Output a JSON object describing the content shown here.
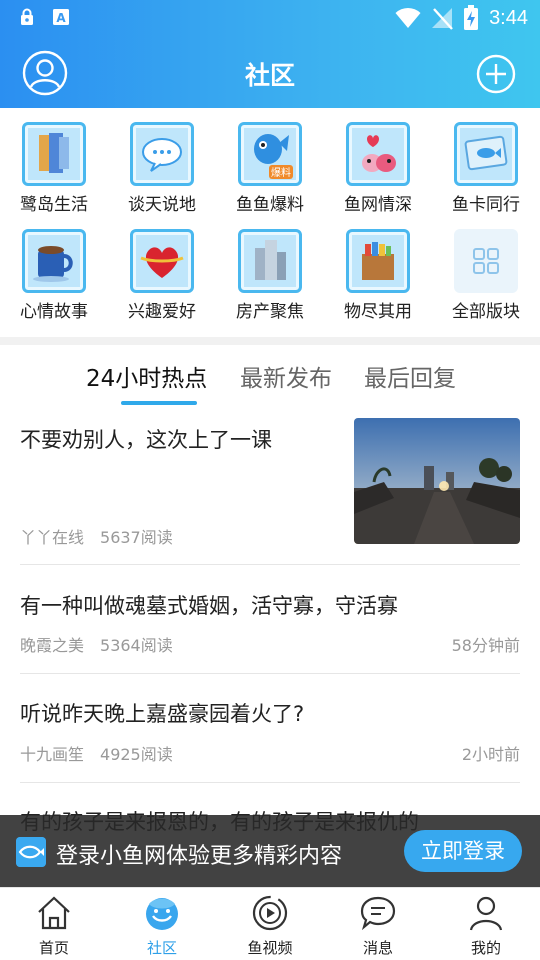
{
  "status_bar": {
    "time": "3:44"
  },
  "header": {
    "title": "社区"
  },
  "forums": [
    {
      "label": "鹭岛生活",
      "icon": "doors-icon"
    },
    {
      "label": "谈天说地",
      "icon": "chat-bubble-icon"
    },
    {
      "label": "鱼鱼爆料",
      "icon": "fish-mascot-icon",
      "badge": "爆料"
    },
    {
      "label": "鱼网情深",
      "icon": "fish-heart-icon"
    },
    {
      "label": "鱼卡同行",
      "icon": "fish-card-icon"
    },
    {
      "label": "心情故事",
      "icon": "coffee-cup-icon"
    },
    {
      "label": "兴趣爱好",
      "icon": "heart-ribbon-icon"
    },
    {
      "label": "房产聚焦",
      "icon": "buildings-icon"
    },
    {
      "label": "物尽其用",
      "icon": "box-icon"
    },
    {
      "label": "全部版块",
      "icon": "grid-icon"
    }
  ],
  "tabs": [
    {
      "label": "24小时热点",
      "active": true
    },
    {
      "label": "最新发布",
      "active": false
    },
    {
      "label": "最后回复",
      "active": false
    }
  ],
  "posts": [
    {
      "title": "不要劝别人，这次上了一课",
      "author": "丫丫在线",
      "reads": "5637阅读",
      "time": "",
      "has_image": true
    },
    {
      "title": "有一种叫做魂墓式婚姻，活守寡，守活寡",
      "author": "晚霞之美",
      "reads": "5364阅读",
      "time": "58分钟前"
    },
    {
      "title": "听说昨天晚上嘉盛豪园着火了?",
      "author": "十九画笙",
      "reads": "4925阅读",
      "time": "2小时前"
    },
    {
      "title": "有的孩子是来报恩的，有的孩子是来报仇的",
      "author": "",
      "reads": "",
      "time": ""
    }
  ],
  "login_banner": {
    "text": "登录小鱼网体验更多精彩内容",
    "button": "立即登录"
  },
  "bottom_nav": [
    {
      "label": "首页",
      "icon": "home-icon",
      "active": false
    },
    {
      "label": "社区",
      "icon": "community-fish-icon",
      "active": true
    },
    {
      "label": "鱼视频",
      "icon": "video-play-icon",
      "active": false
    },
    {
      "label": "消息",
      "icon": "message-bubble-icon",
      "active": false
    },
    {
      "label": "我的",
      "icon": "person-icon",
      "active": false
    }
  ],
  "colors": {
    "accent": "#2fa9ea",
    "header_start": "#2b8ff1",
    "header_end": "#3fc6ef"
  }
}
